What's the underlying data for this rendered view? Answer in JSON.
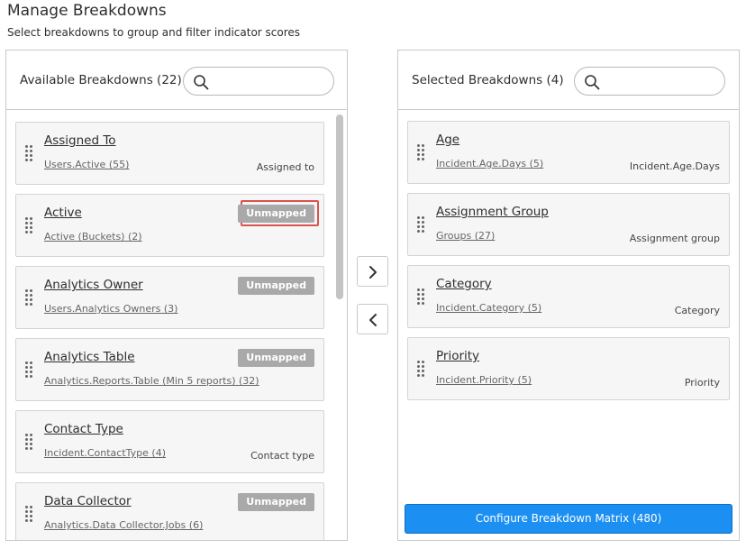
{
  "header": {
    "title": "Manage Breakdowns",
    "subtitle": "Select breakdowns to group and filter indicator scores"
  },
  "available": {
    "title": "Available Breakdowns (22)",
    "search_value": "",
    "items": [
      {
        "name": "Assigned To",
        "source": "Users.Active (55)",
        "label": "Assigned to",
        "badge": ""
      },
      {
        "name": "Active",
        "source": "Active (Buckets) (2)",
        "label": "",
        "badge": "Unmapped"
      },
      {
        "name": "Analytics Owner",
        "source": "Users.Analytics Owners (3)",
        "label": "",
        "badge": "Unmapped"
      },
      {
        "name": "Analytics Table",
        "source": "Analytics.Reports.Table (Min 5 reports) (32)",
        "label": "",
        "badge": "Unmapped"
      },
      {
        "name": "Contact Type",
        "source": "Incident.ContactType (4)",
        "label": "Contact type",
        "badge": ""
      },
      {
        "name": "Data Collector",
        "source": "Analytics.Data Collector.Jobs (6)",
        "label": "",
        "badge": "Unmapped"
      }
    ]
  },
  "selected": {
    "title": "Selected Breakdowns (4)",
    "search_value": "",
    "items": [
      {
        "name": "Age",
        "source": "Incident.Age.Days (5)",
        "label": "Incident.Age.Days"
      },
      {
        "name": "Assignment Group",
        "source": "Groups (27)",
        "label": "Assignment group"
      },
      {
        "name": "Category",
        "source": "Incident.Category (5)",
        "label": "Category"
      },
      {
        "name": "Priority",
        "source": "Incident.Priority (5)",
        "label": "Priority"
      }
    ],
    "configure_label": "Configure Breakdown Matrix (480)"
  },
  "colors": {
    "accent": "#1b8ff2",
    "badge": "#a9a9a9",
    "highlight": "#d9534f"
  },
  "icons": {
    "search": "search-icon",
    "move_right": "chevron-right-icon",
    "move_left": "chevron-left-icon",
    "drag": "drag-handle-icon"
  }
}
